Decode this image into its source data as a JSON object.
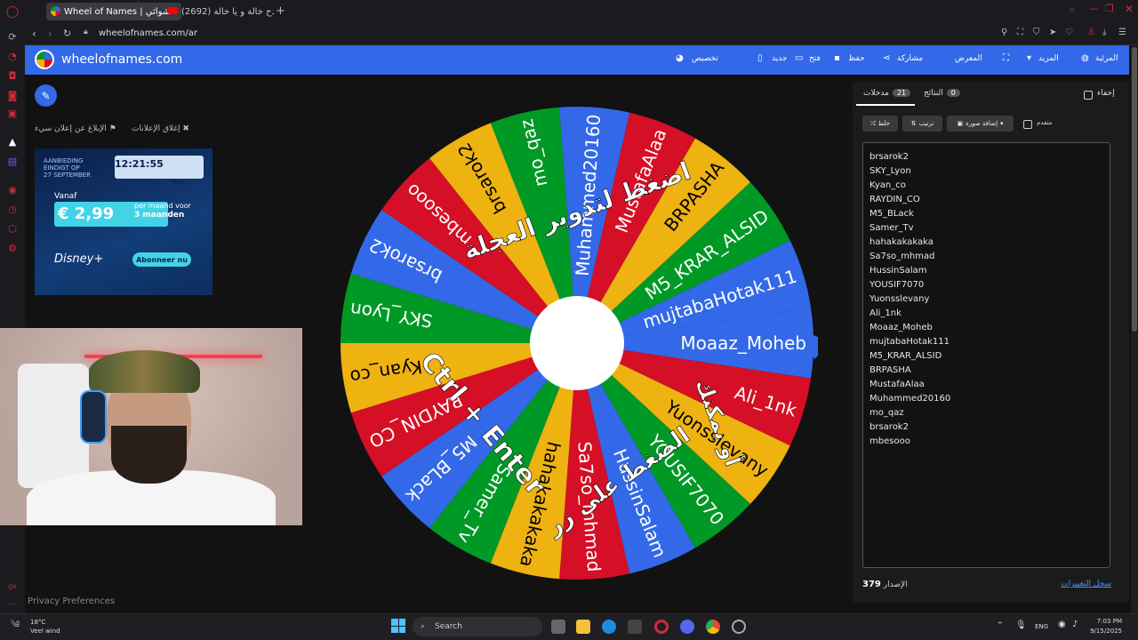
{
  "browser": {
    "tabs": [
      {
        "label": "Wheel of Names | عشوائي",
        "active": true
      },
      {
        "label": "(2692) ردح خالة و يا خالة - ■",
        "active": false
      }
    ],
    "url": "wheelofnames.com/ar"
  },
  "header": {
    "site_name": "wheelofnames.com",
    "menu": [
      "المرئية",
      "المزيد",
      "المعرض",
      "مشاركة",
      "حفظ",
      "فتح",
      "جديد",
      "تخصيص"
    ]
  },
  "left": {
    "close_ads": "إغلاق الإعلانات",
    "report_ad": "الإبلاغ عن إعلان سيء",
    "ad": {
      "offer_line1": "AANBIEDING",
      "offer_line2": "EINDIGT OP",
      "offer_line3": "27 SEPTEMBER",
      "days": "12",
      "hours": "21",
      "minutes": "55",
      "days_label": "dagen",
      "hours_label": "uren",
      "minutes_label": "minuten",
      "vanaf": "Vanaf",
      "price": "€ 2,99",
      "price_detail_1": "per maand voor",
      "price_detail_2": "3 maanden",
      "brand": "Disney+",
      "cta": "Abonneer nu"
    },
    "privacy": "Privacy Preferences"
  },
  "wheel": {
    "overlay_top": "اضغط لتدوير العجلة",
    "overlay_or": "أو يمكنك",
    "overlay_bottom": "الضغط على زر",
    "overlay_keys": "Ctrl + Enter",
    "colors": [
      "#3369e8",
      "#d50f25",
      "#eeb211",
      "#009925"
    ],
    "segments": [
      "Moaaz_Moheb",
      "Ali_1nk",
      "Yuonsslevany",
      "YOUSIF7070",
      "HussinSalam",
      "Sa7so_mhmad",
      "hahakakakaka",
      "Samer_Tv",
      "M5_BLack",
      "RAYDIN_CO",
      "Kyan_co",
      "SKY_Lyon",
      "brsarok2",
      "mbesooo",
      "brsarok2",
      "mo_qaz",
      "Muhammed20160",
      "MustafaAlaa",
      "BRPASHA",
      "M5_KRAR_ALSID",
      "mujtabaHotak111"
    ]
  },
  "panel": {
    "tab_entries": "مدخلات",
    "tab_entries_count": "21",
    "tab_results": "النتائج",
    "tab_results_count": "0",
    "hide": "إخفاء",
    "shuffle": "خلط",
    "sort": "ترتيب",
    "add_image": "إضافة صورة",
    "advanced": "متقدم",
    "entries": [
      "brsarok2",
      "SKY_Lyon",
      "Kyan_co",
      "RAYDIN_CO",
      "M5_BLack",
      "Samer_Tv",
      "hahakakakaka",
      "Sa7so_mhmad",
      "HussinSalam",
      "YOUSIF7070",
      "Yuonsslevany",
      "Ali_1nk",
      "Moaaz_Moheb",
      "mujtabaHotak111",
      "M5_KRAR_ALSID",
      "BRPASHA",
      "MustafaAlaa",
      "Muhammed20160",
      "mo_qaz",
      "brsarok2",
      "mbesooo"
    ],
    "version_label": "الإصدار",
    "version_number": "379",
    "changelog": "سجل التغييرات"
  },
  "taskbar": {
    "temp": "18°C",
    "weather": "Veel wind",
    "search": "Search",
    "lang": "ENG",
    "time": "7:03 PM",
    "date": "9/15/2025"
  }
}
